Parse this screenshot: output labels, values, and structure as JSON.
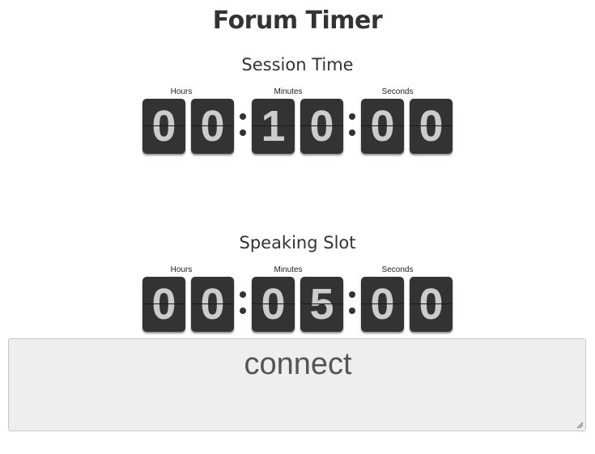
{
  "page": {
    "title": "Forum Timer"
  },
  "session_timer": {
    "title": "Session Time",
    "labels": {
      "hours": "Hours",
      "minutes": "Minutes",
      "seconds": "Seconds"
    },
    "digits": [
      "0",
      "0",
      "1",
      "0",
      "0",
      "0"
    ]
  },
  "speaking_timer": {
    "title": "Speaking Slot",
    "labels": {
      "hours": "Hours",
      "minutes": "Minutes",
      "seconds": "Seconds"
    },
    "digits": [
      "0",
      "0",
      "0",
      "5",
      "0",
      "0"
    ]
  },
  "connect_field": {
    "value": "connect"
  },
  "colors": {
    "digit_card": "#333333",
    "digit_text": "#cccccc",
    "connect_background": "#eeeeee"
  }
}
